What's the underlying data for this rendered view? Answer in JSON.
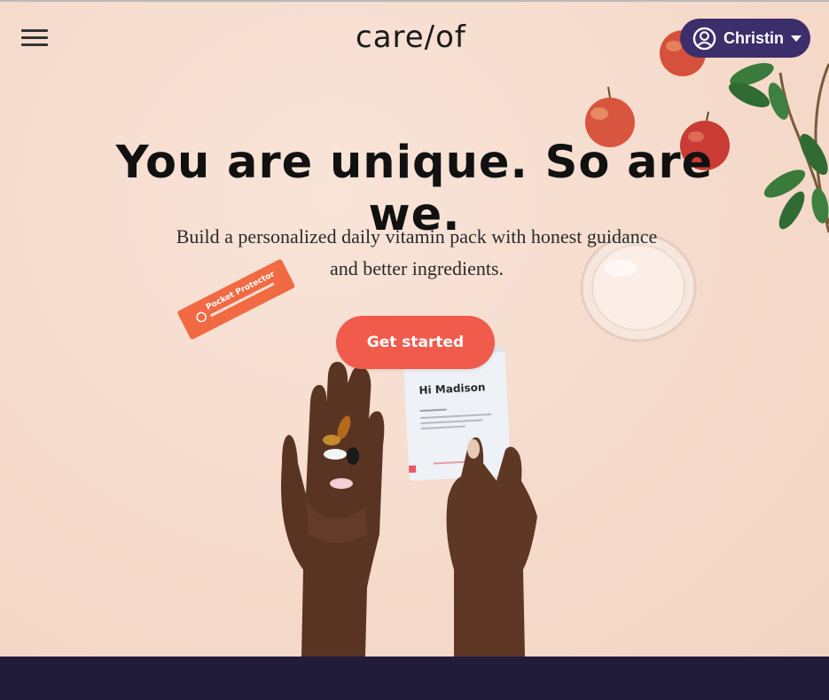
{
  "header": {
    "logo": "care/of",
    "user": {
      "name": "Christin"
    }
  },
  "hero": {
    "headline": "You are unique. So are we.",
    "subhead": "Build a personalized daily vitamin pack with honest guidance and better ingredients.",
    "cta_label": "Get started",
    "packet": {
      "greeting": "Hi Madison"
    },
    "stick_pack": {
      "label": "Pocket Protector"
    }
  },
  "colors": {
    "background": "#f6dfd2",
    "cta": "#f15b4c",
    "user_pill": "#3c2e6b",
    "footer": "#221c3b"
  }
}
